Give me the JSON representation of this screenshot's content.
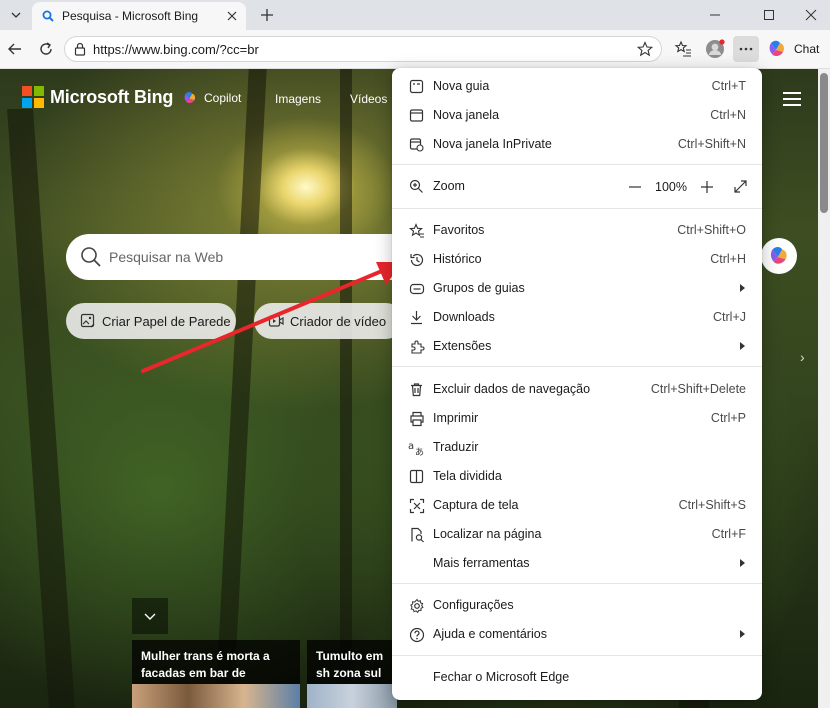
{
  "browser": {
    "tab": {
      "title": "Pesquisa - Microsoft Bing"
    },
    "address": {
      "url": "https://www.bing.com/?cc=br"
    },
    "chat_label": "Chat"
  },
  "page": {
    "brand": "Microsoft Bing",
    "nav": {
      "copilot": "Copilot",
      "images": "Imagens",
      "videos": "Vídeos"
    },
    "search": {
      "placeholder": "Pesquisar na Web"
    },
    "chips": [
      "Criar Papel de Parede",
      "Criador de vídeo"
    ],
    "news": [
      {
        "text": "Mulher trans é morta a facadas em bar de cidade..."
      },
      {
        "text": "Tumulto em sh zona sul de SP"
      }
    ]
  },
  "menu": {
    "items": [
      {
        "label": "Nova guia",
        "shortcut": "Ctrl+T",
        "icon": "new-tab-icon"
      },
      {
        "label": "Nova janela",
        "shortcut": "Ctrl+N",
        "icon": "new-window-icon"
      },
      {
        "label": "Nova janela InPrivate",
        "shortcut": "Ctrl+Shift+N",
        "icon": "inprivate-icon"
      },
      {
        "label": "Zoom",
        "icon": "zoom-icon"
      },
      {
        "label": "Favoritos",
        "shortcut": "Ctrl+Shift+O",
        "icon": "favorites-icon"
      },
      {
        "label": "Histórico",
        "shortcut": "Ctrl+H",
        "icon": "history-icon"
      },
      {
        "label": "Grupos de guias",
        "icon": "tab-groups-icon",
        "submenu": true
      },
      {
        "label": "Downloads",
        "shortcut": "Ctrl+J",
        "icon": "download-icon"
      },
      {
        "label": "Extensões",
        "icon": "extensions-icon",
        "submenu": true
      },
      {
        "label": "Excluir dados de navegação",
        "shortcut": "Ctrl+Shift+Delete",
        "icon": "trash-icon"
      },
      {
        "label": "Imprimir",
        "shortcut": "Ctrl+P",
        "icon": "print-icon"
      },
      {
        "label": "Traduzir",
        "icon": "translate-icon"
      },
      {
        "label": "Tela dividida",
        "icon": "split-screen-icon"
      },
      {
        "label": "Captura de tela",
        "shortcut": "Ctrl+Shift+S",
        "icon": "screenshot-icon"
      },
      {
        "label": "Localizar na página",
        "shortcut": "Ctrl+F",
        "icon": "find-icon"
      },
      {
        "label": "Mais ferramentas",
        "submenu": true
      },
      {
        "label": "Configurações",
        "icon": "gear-icon"
      },
      {
        "label": "Ajuda e comentários",
        "icon": "help-icon",
        "submenu": true
      },
      {
        "label": "Fechar o Microsoft Edge"
      }
    ],
    "zoom_value": "100%"
  },
  "colors": {
    "annotation_arrow": "#e8262b",
    "menu_hover": "#f0f0f0"
  }
}
